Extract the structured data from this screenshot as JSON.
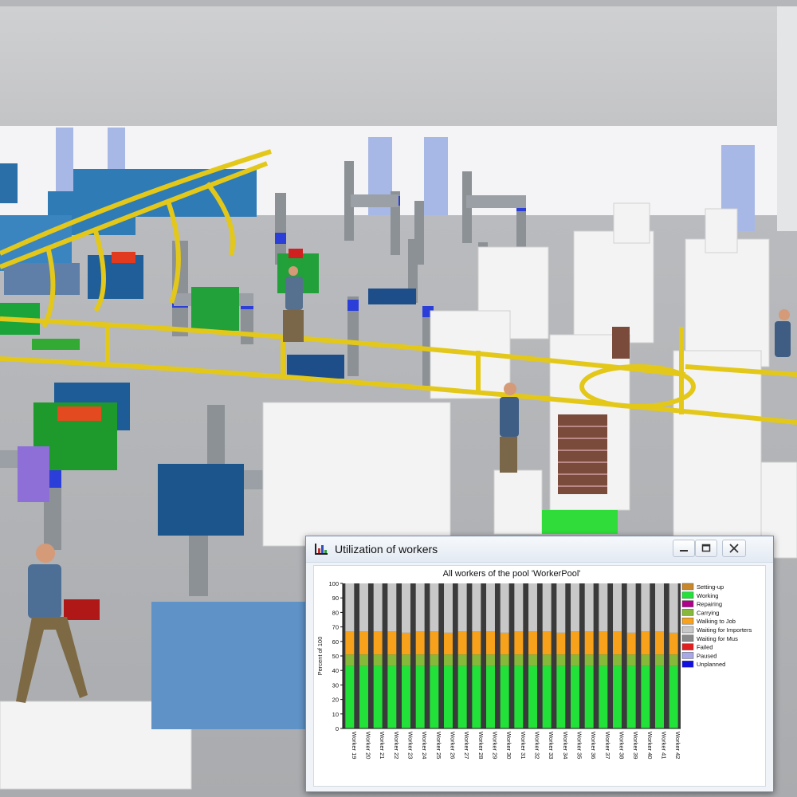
{
  "window": {
    "title": "Utilization of workers",
    "controls": [
      "minimize",
      "maximize",
      "close"
    ]
  },
  "icons": {
    "chart_window": "bar-chart-icon",
    "minimize": "minimize-icon",
    "maximize": "maximize-icon",
    "close": "close-icon"
  },
  "chart_data": {
    "type": "bar",
    "stacked": true,
    "title": "All workers of the pool 'WorkerPool'",
    "ylabel": "Percent of 100",
    "xlabel": "",
    "ylim": [
      0,
      100
    ],
    "yticks": [
      0,
      10,
      20,
      30,
      40,
      50,
      60,
      70,
      80,
      90,
      100
    ],
    "grid": false,
    "legend_position": "right",
    "categories": [
      "Worker 19",
      "Worker 20",
      "Worker 21",
      "Worker 22",
      "Worker 23",
      "Worker 24",
      "Worker 25",
      "Worker 26",
      "Worker 27",
      "Worker 28",
      "Worker 29",
      "Worker 30",
      "Worker 31",
      "Worker 32",
      "Worker 33",
      "Worker 34",
      "Worker 35",
      "Worker 36",
      "Worker 37",
      "Worker 38",
      "Worker 39",
      "Worker 40",
      "Worker 41",
      "Worker 42"
    ],
    "series": [
      {
        "name": "Setting-up",
        "color": "#c8882a",
        "values": [
          0,
          0,
          0,
          0,
          0,
          0,
          0,
          0,
          0,
          0,
          0,
          0,
          0,
          0,
          0,
          0,
          0,
          0,
          0,
          0,
          0,
          0,
          0,
          0
        ]
      },
      {
        "name": "Working",
        "color": "#22e23a",
        "values": [
          43,
          43,
          43,
          43,
          43,
          43,
          43,
          43,
          43,
          43,
          43,
          43,
          43,
          43,
          43,
          43,
          43,
          43,
          43,
          43,
          43,
          43,
          43,
          43
        ]
      },
      {
        "name": "Repairing",
        "color": "#b0008c",
        "values": [
          0,
          0,
          0,
          0,
          0,
          0,
          0,
          0,
          0,
          0,
          0,
          0,
          0,
          0,
          0,
          0,
          0,
          0,
          0,
          0,
          0,
          0,
          0,
          0
        ]
      },
      {
        "name": "Carrying",
        "color": "#86b83a",
        "values": [
          8,
          8,
          8,
          8,
          8,
          8,
          8,
          8,
          8,
          8,
          8,
          8,
          8,
          8,
          8,
          8,
          8,
          8,
          8,
          8,
          8,
          8,
          8,
          8
        ]
      },
      {
        "name": "Walking to Job",
        "color": "#f7a21a",
        "values": [
          16,
          16,
          16,
          16,
          15,
          16,
          16,
          15,
          16,
          16,
          16,
          15,
          16,
          16,
          16,
          15,
          16,
          16,
          16,
          16,
          15,
          16,
          16,
          15
        ]
      },
      {
        "name": "Waiting for Importers",
        "color": "#c8c8c8",
        "values": [
          33,
          33,
          33,
          33,
          34,
          33,
          33,
          34,
          33,
          33,
          33,
          34,
          33,
          33,
          33,
          34,
          33,
          33,
          33,
          33,
          34,
          33,
          33,
          34
        ]
      },
      {
        "name": "Waiting for Mus",
        "color": "#8a8a8a",
        "values": [
          0,
          0,
          0,
          0,
          0,
          0,
          0,
          0,
          0,
          0,
          0,
          0,
          0,
          0,
          0,
          0,
          0,
          0,
          0,
          0,
          0,
          0,
          0,
          0
        ]
      },
      {
        "name": "Failed",
        "color": "#e02020",
        "values": [
          0,
          0,
          0,
          0,
          0,
          0,
          0,
          0,
          0,
          0,
          0,
          0,
          0,
          0,
          0,
          0,
          0,
          0,
          0,
          0,
          0,
          0,
          0,
          0
        ]
      },
      {
        "name": "Paused",
        "color": "#a8a8e8",
        "values": [
          0,
          0,
          0,
          0,
          0,
          0,
          0,
          0,
          0,
          0,
          0,
          0,
          0,
          0,
          0,
          0,
          0,
          0,
          0,
          0,
          0,
          0,
          0,
          0
        ]
      },
      {
        "name": "Unplanned",
        "color": "#1010e0",
        "values": [
          0,
          0,
          0,
          0,
          0,
          0,
          0,
          0,
          0,
          0,
          0,
          0,
          0,
          0,
          0,
          0,
          0,
          0,
          0,
          0,
          0,
          0,
          0,
          0
        ]
      }
    ]
  }
}
